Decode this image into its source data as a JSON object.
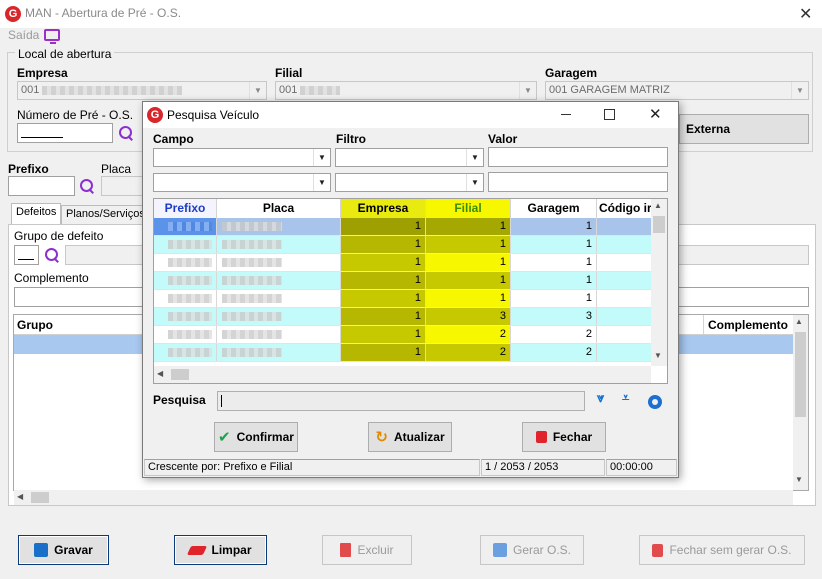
{
  "window": {
    "title": "MAN - Abertura de Pré - O.S."
  },
  "menu": {
    "saida": "Saída"
  },
  "local": {
    "legend": "Local de abertura",
    "empresa_label": "Empresa",
    "empresa_value": "001",
    "filial_label": "Filial",
    "filial_value": "001",
    "garagem_label": "Garagem",
    "garagem_value": "001 GARAGEM MATRIZ",
    "numero_label": "Número de Pré - O.S.",
    "externa_label": "Externa"
  },
  "veiculo": {
    "prefixo_label": "Prefixo",
    "placa_label": "Placa"
  },
  "tabs": [
    "Defeitos",
    "Planos/Serviços"
  ],
  "defeitos": {
    "grupo_label": "Grupo de defeito",
    "complemento_label": "Complemento",
    "grid_headers": {
      "grupo": "Grupo",
      "complemento": "Complemento"
    }
  },
  "footer": {
    "gravar": "Gravar",
    "limpar": "Limpar",
    "excluir": "Excluir",
    "gerar_os": "Gerar O.S.",
    "fechar_sem_gerar": "Fechar sem gerar O.S."
  },
  "dialog": {
    "title": "Pesquisa Veículo",
    "filter_headers": {
      "campo": "Campo",
      "filtro": "Filtro",
      "valor": "Valor"
    },
    "grid_headers": [
      "Prefixo",
      "Placa",
      "Empresa",
      "Filial",
      "Garagem",
      "Código ir"
    ],
    "rows": [
      {
        "empresa": "1",
        "filial": "1",
        "garagem": "1"
      },
      {
        "empresa": "1",
        "filial": "1",
        "garagem": "1"
      },
      {
        "empresa": "1",
        "filial": "1",
        "garagem": "1"
      },
      {
        "empresa": "1",
        "filial": "1",
        "garagem": "1"
      },
      {
        "empresa": "1",
        "filial": "1",
        "garagem": "1"
      },
      {
        "empresa": "1",
        "filial": "3",
        "garagem": "3"
      },
      {
        "empresa": "1",
        "filial": "2",
        "garagem": "2"
      },
      {
        "empresa": "1",
        "filial": "2",
        "garagem": "2"
      }
    ],
    "pesquisa_label": "Pesquisa",
    "buttons": {
      "confirmar": "Confirmar",
      "atualizar": "Atualizar",
      "fechar": "Fechar"
    },
    "status": {
      "order": "Crescente por: Prefixo e Filial",
      "position": "1 / 2053 / 2053",
      "time": "00:00:00"
    }
  },
  "colors": {
    "accent": "#1570d0",
    "purple": "#8b2fcf",
    "red": "#d8262b",
    "yellow": "#f7f700",
    "olive": "#b5b700",
    "cyan": "#c3fbfb"
  }
}
